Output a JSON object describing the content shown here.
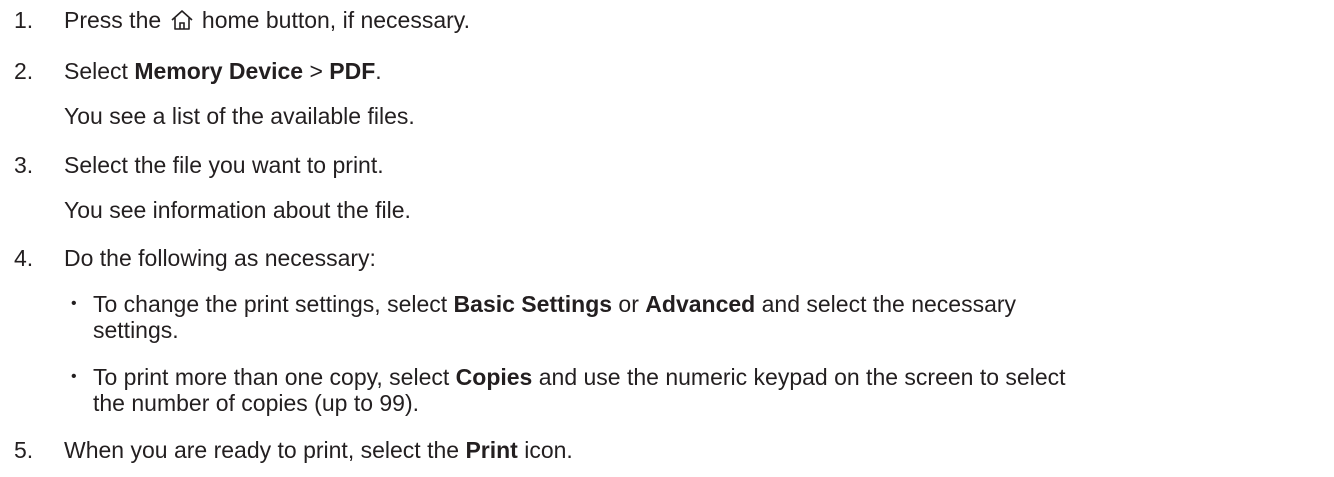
{
  "steps": [
    {
      "number": "1.",
      "parts": [
        "Press the ",
        " home button, if necessary."
      ]
    },
    {
      "number": "2.",
      "parts": [
        "Select ",
        "Memory Device",
        " > ",
        "PDF",
        "."
      ],
      "result": "You see a list of the available files."
    },
    {
      "number": "3.",
      "text": "Select the file you want to print.",
      "result": "You see information about the file."
    },
    {
      "number": "4.",
      "text": "Do the following as necessary:",
      "bullets": [
        {
          "marker": "•",
          "line1": [
            "To change the print settings, select ",
            "Basic Settings",
            " or ",
            "Advanced",
            " and select the necessary"
          ],
          "line2": "settings."
        },
        {
          "marker": "•",
          "line1": [
            "To print more than one copy, select ",
            "Copies",
            " and use the numeric keypad on the screen to select"
          ],
          "line2": "the number of copies (up to 99)."
        }
      ]
    },
    {
      "number": "5.",
      "parts": [
        "When you are ready to print, select the ",
        "Print",
        " icon."
      ]
    }
  ],
  "icons": {
    "home": "home-icon"
  }
}
